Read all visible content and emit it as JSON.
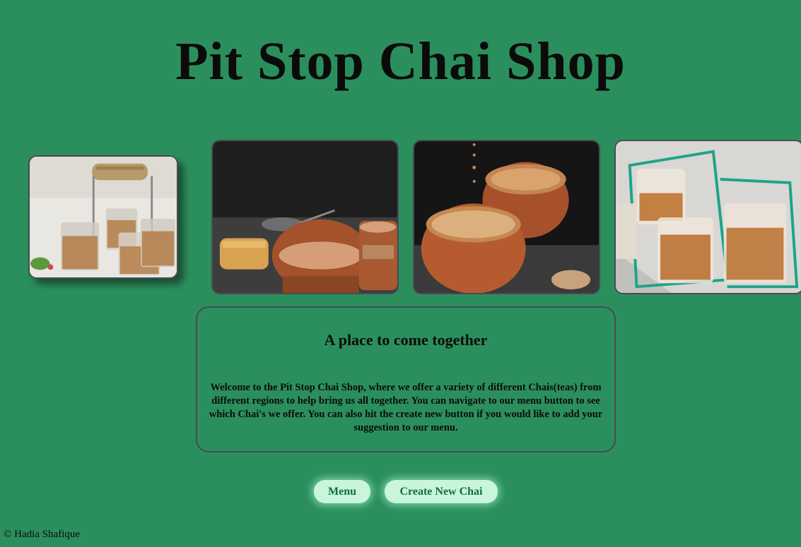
{
  "header": {
    "title": "Pit Stop Chai Shop"
  },
  "gallery": {
    "images": [
      {
        "name": "chai-carrier-glasses-photo"
      },
      {
        "name": "chai-clay-cups-rusk-photo"
      },
      {
        "name": "chai-pouring-clay-cups-photo"
      },
      {
        "name": "chai-glasses-green-stand-photo"
      }
    ]
  },
  "info": {
    "heading": "A place to come together",
    "text": "Welcome to the Pit Stop Chai Shop, where we offer a variety of different Chais(teas) from different regions to help bring us all together. You can navigate to our menu button to see which Chai's we offer. You can also hit the create new button if you would like to add your suggestion to our menu."
  },
  "buttons": {
    "menu_label": "Menu",
    "create_label": "Create New Chai"
  },
  "footer": {
    "copyright": "© Hadia Shafique"
  },
  "colors": {
    "background": "#2b8f5d",
    "button_bg": "#c8f5dc",
    "button_text": "#11703a"
  }
}
